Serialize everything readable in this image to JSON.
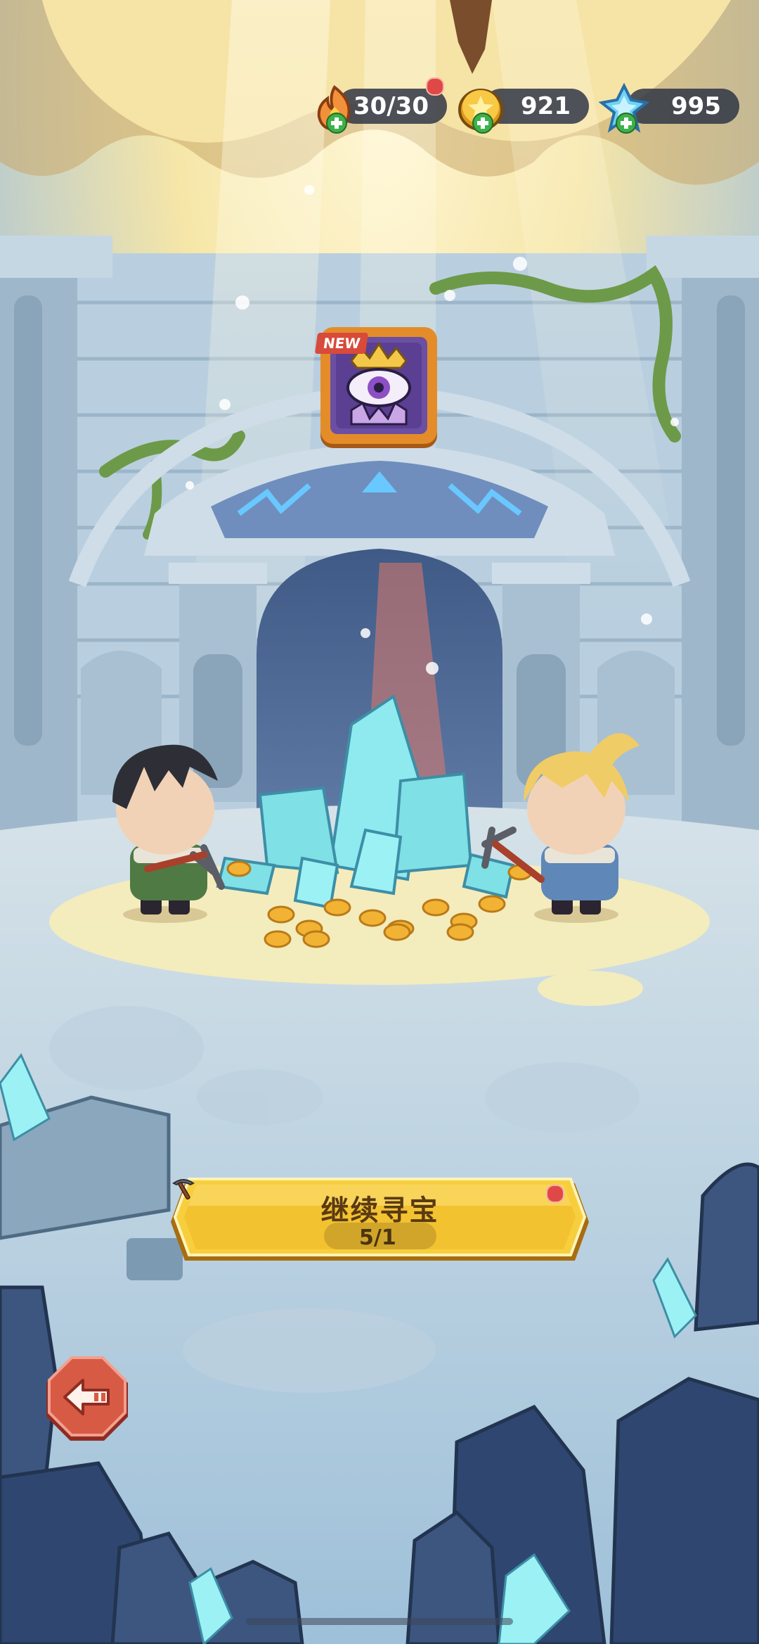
{
  "resources": {
    "energy": {
      "value": "30/30",
      "icon": "flame-energy-icon",
      "has_notification": true
    },
    "gold": {
      "value": "921",
      "icon": "gold-coin-icon"
    },
    "gems": {
      "value": "995",
      "icon": "ice-crystal-icon"
    }
  },
  "reward_item": {
    "badge": "NEW",
    "icon": "eye-crown-book-icon"
  },
  "continue_button": {
    "label": "继续寻宝",
    "count": "5/1",
    "icon": "pickaxe-icon",
    "has_notification": true
  },
  "back_button": {
    "icon": "back-arrow-icon"
  },
  "colors": {
    "button_gold": "#f7cf3e",
    "button_border": "#d49a1c",
    "back_red": "#c94a3a",
    "crystal": "#7fe0e6",
    "coin": "#f2b233"
  }
}
